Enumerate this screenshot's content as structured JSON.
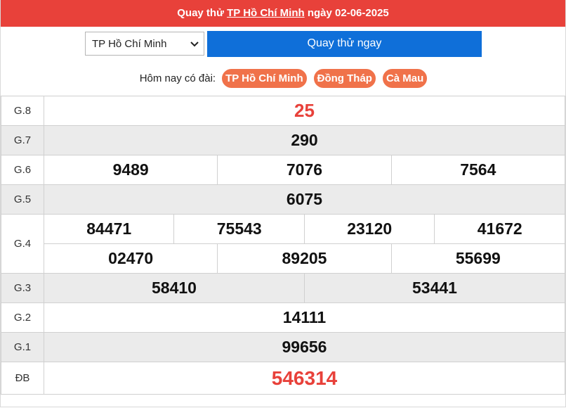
{
  "header": {
    "prefix": "Quay thử",
    "link": "TP Hồ Chí Minh",
    "suffix": "ngày 02-06-2025"
  },
  "controls": {
    "select_value": "TP Hồ Chí Minh",
    "button_label": "Quay thử ngay"
  },
  "today": {
    "label": "Hôm nay có đài:",
    "stations": [
      "TP Hồ Chí Minh",
      "Đồng Tháp",
      "Cà Mau"
    ]
  },
  "results": {
    "g8": {
      "label": "G.8",
      "values": [
        "25"
      ]
    },
    "g7": {
      "label": "G.7",
      "values": [
        "290"
      ]
    },
    "g6": {
      "label": "G.6",
      "values": [
        "9489",
        "7076",
        "7564"
      ]
    },
    "g5": {
      "label": "G.5",
      "values": [
        "6075"
      ]
    },
    "g4": {
      "label": "G.4",
      "row1": [
        "84471",
        "75543",
        "23120",
        "41672"
      ],
      "row2": [
        "02470",
        "89205",
        "55699"
      ]
    },
    "g3": {
      "label": "G.3",
      "values": [
        "58410",
        "53441"
      ]
    },
    "g2": {
      "label": "G.2",
      "values": [
        "14111"
      ]
    },
    "g1": {
      "label": "G.1",
      "values": [
        "99656"
      ]
    },
    "db": {
      "label": "ĐB",
      "values": [
        "546314"
      ]
    }
  },
  "colors": {
    "header_bg": "#e8413a",
    "button_bg": "#0f6fd9",
    "pill_bg": "#f0724a",
    "highlight_text": "#e8413a"
  }
}
